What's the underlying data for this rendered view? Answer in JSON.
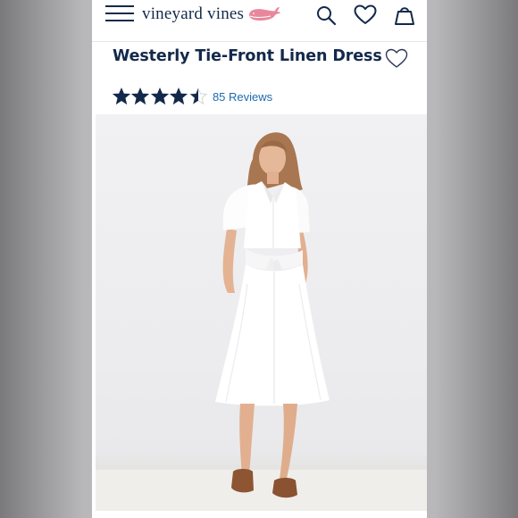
{
  "header": {
    "brand_name": "vineyard vines",
    "menu_icon": "hamburger-menu-icon",
    "logo_icon": "pink-whale-logo-icon",
    "search_icon": "search-icon",
    "wishlist_icon": "heart-icon",
    "bag_icon": "shopping-bag-icon"
  },
  "product": {
    "title": "Westerly Tie-Front Linen Dress",
    "favorite_icon": "heart-outline-icon",
    "rating": 4.5,
    "rating_max": 5,
    "reviews_label": "85 Reviews",
    "image_alt_icon": "product-photo"
  },
  "colors": {
    "navy": "#13294b",
    "link_blue": "#1e6ab0",
    "whale_pink": "#e8879b",
    "star_empty": "#c9c9c9"
  }
}
